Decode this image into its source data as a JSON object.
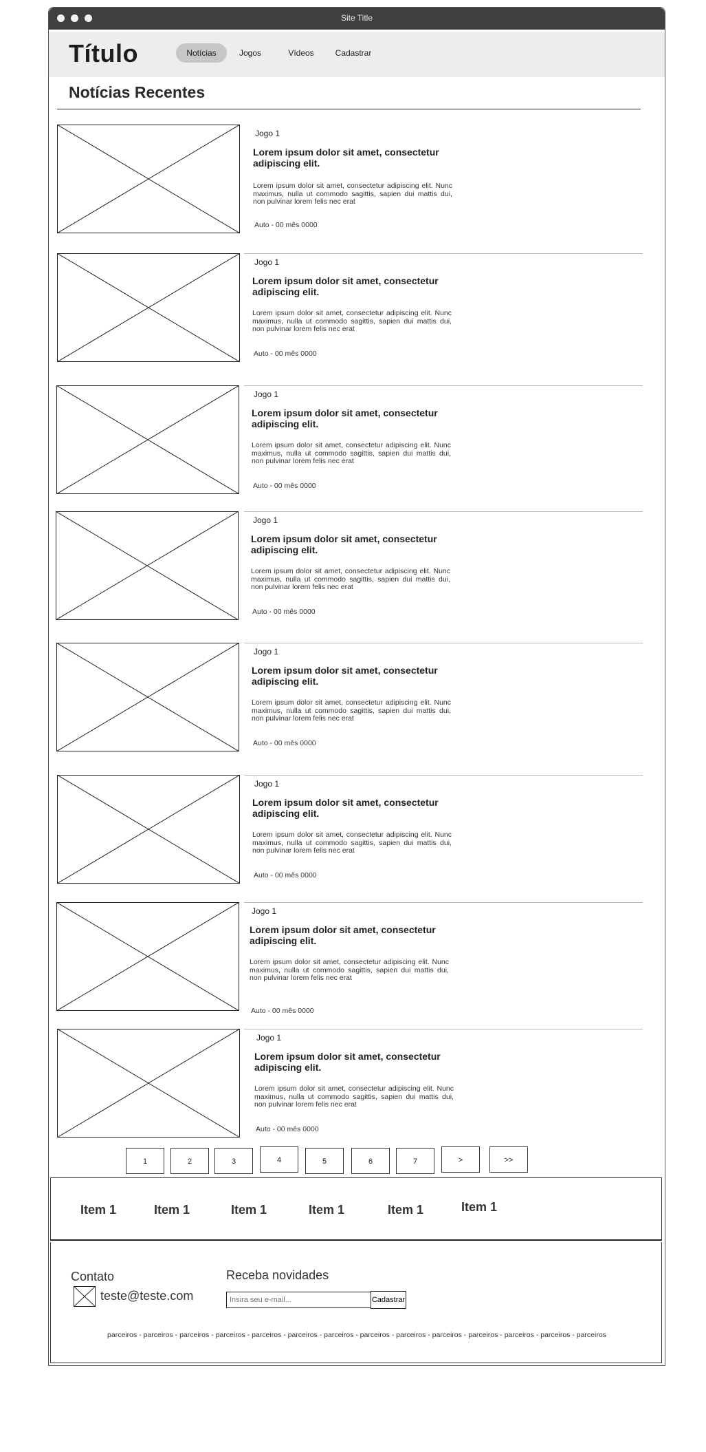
{
  "window": {
    "title": "Site Title"
  },
  "header": {
    "brand": "Título",
    "nav": [
      "Notícias",
      "Jogos",
      "Vídeos",
      "Cadastrar"
    ],
    "active_nav": "Notícias"
  },
  "main": {
    "section_title": "Notícias Recentes",
    "articles": [
      {
        "tag": "Jogo 1",
        "headline": "Lorem ipsum dolor sit amet, consectetur adipiscing elit.",
        "excerpt": "Lorem ipsum dolor sit amet, consectetur adipiscing elit. Nunc maximus, nulla ut commodo sagittis, sapien dui mattis dui, non pulvinar lorem felis nec erat",
        "meta": "Auto - 00 mês 0000"
      },
      {
        "tag": "Jogo 1",
        "headline": "Lorem ipsum dolor sit amet, consectetur adipiscing elit.",
        "excerpt": "Lorem ipsum dolor sit amet, consectetur adipiscing elit. Nunc maximus, nulla ut commodo sagittis, sapien dui mattis dui, non pulvinar lorem felis nec erat",
        "meta": "Auto - 00 mês 0000"
      },
      {
        "tag": "Jogo 1",
        "headline": "Lorem ipsum dolor sit amet, consectetur adipiscing elit.",
        "excerpt": "Lorem ipsum dolor sit amet, consectetur adipiscing elit. Nunc maximus, nulla ut commodo sagittis, sapien dui mattis dui, non pulvinar lorem felis nec erat",
        "meta": "Auto - 00 mês 0000"
      },
      {
        "tag": "Jogo 1",
        "headline": "Lorem ipsum dolor sit amet, consectetur adipiscing elit.",
        "excerpt": "Lorem ipsum dolor sit amet, consectetur adipiscing elit. Nunc maximus, nulla ut commodo sagittis, sapien dui mattis dui, non pulvinar lorem felis nec erat",
        "meta": "Auto - 00 mês 0000"
      },
      {
        "tag": "Jogo 1",
        "headline": "Lorem ipsum dolor sit amet, consectetur adipiscing elit.",
        "excerpt": "Lorem ipsum dolor sit amet, consectetur adipiscing elit. Nunc maximus, nulla ut commodo sagittis, sapien dui mattis dui, non pulvinar lorem felis nec erat",
        "meta": "Auto - 00 mês 0000"
      },
      {
        "tag": "Jogo 1",
        "headline": "Lorem ipsum dolor sit amet, consectetur adipiscing elit.",
        "excerpt": "Lorem ipsum dolor sit amet, consectetur adipiscing elit. Nunc maximus, nulla ut commodo sagittis, sapien dui mattis dui, non pulvinar lorem felis nec erat",
        "meta": "Auto - 00 mês 0000"
      },
      {
        "tag": "Jogo 1",
        "headline": "Lorem ipsum dolor sit amet, consectetur adipiscing elit.",
        "excerpt": "Lorem ipsum dolor sit amet, consectetur adipiscing elit. Nunc maximus, nulla ut commodo sagittis, sapien dui mattis dui, non pulvinar lorem felis nec erat",
        "meta": "Auto - 00 mês 0000"
      },
      {
        "tag": "Jogo 1",
        "headline": "Lorem ipsum dolor sit amet, consectetur adipiscing elit.",
        "excerpt": "Lorem ipsum dolor sit amet, consectetur adipiscing elit. Nunc maximus, nulla ut commodo sagittis, sapien dui mattis dui, non pulvinar lorem felis nec erat",
        "meta": "Auto - 00 mês 0000"
      }
    ],
    "pagination": [
      "1",
      "2",
      "3",
      "4",
      "5",
      "6",
      "7",
      ">",
      ">>"
    ]
  },
  "categories": [
    "Item 1",
    "Item 1",
    "Item 1",
    "Item 1",
    "Item 1",
    "Item 1"
  ],
  "footer": {
    "contact_label": "Contato",
    "contact_icon": "mail-icon",
    "email": "teste@teste.com",
    "newsletter_label": "Receba novidades",
    "newsletter_placeholder": "Insira seu e-mail...",
    "newsletter_button": "Cadastrar",
    "partners": "parceiros - parceiros - parceiros - parceiros - parceiros - parceiros - parceiros - parceiros - parceiros - parceiros - parceiros - parceiros - parceiros - parceiros"
  }
}
